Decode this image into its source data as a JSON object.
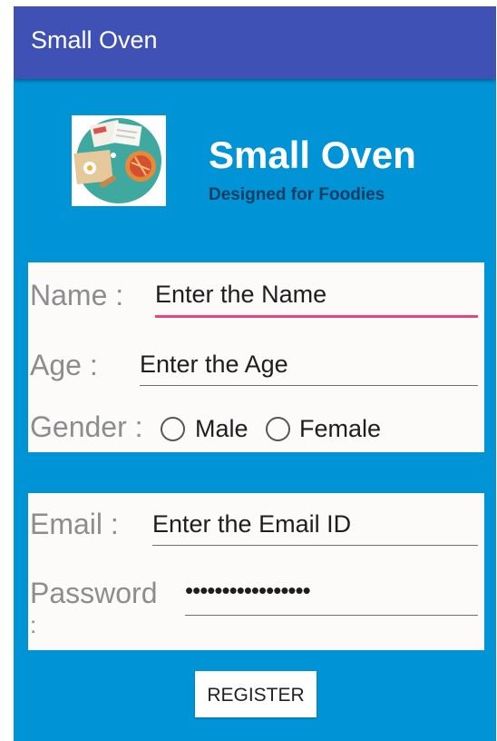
{
  "app_bar": {
    "title": "Small Oven"
  },
  "brand": {
    "title": "Small Oven",
    "tagline": "Designed for Foodies",
    "logo_icon": "cooking-plate-icon"
  },
  "form": {
    "name": {
      "label": "Name :",
      "placeholder": "Enter the Name"
    },
    "age": {
      "label": "Age :",
      "placeholder": "Enter the Age"
    },
    "gender": {
      "label": "Gender :",
      "options": [
        "Male",
        "Female"
      ]
    },
    "email": {
      "label": "Email :",
      "placeholder": "Enter the Email ID"
    },
    "password": {
      "label": "Password",
      "label_cont": ":",
      "masked_value": "•••••••••••••••••"
    }
  },
  "register_button": {
    "label": "REGISTER"
  },
  "colors": {
    "app_bar": "#3f51b5",
    "background": "#0094d6",
    "accent": "#e8457a",
    "tagline": "#0d3e63"
  }
}
